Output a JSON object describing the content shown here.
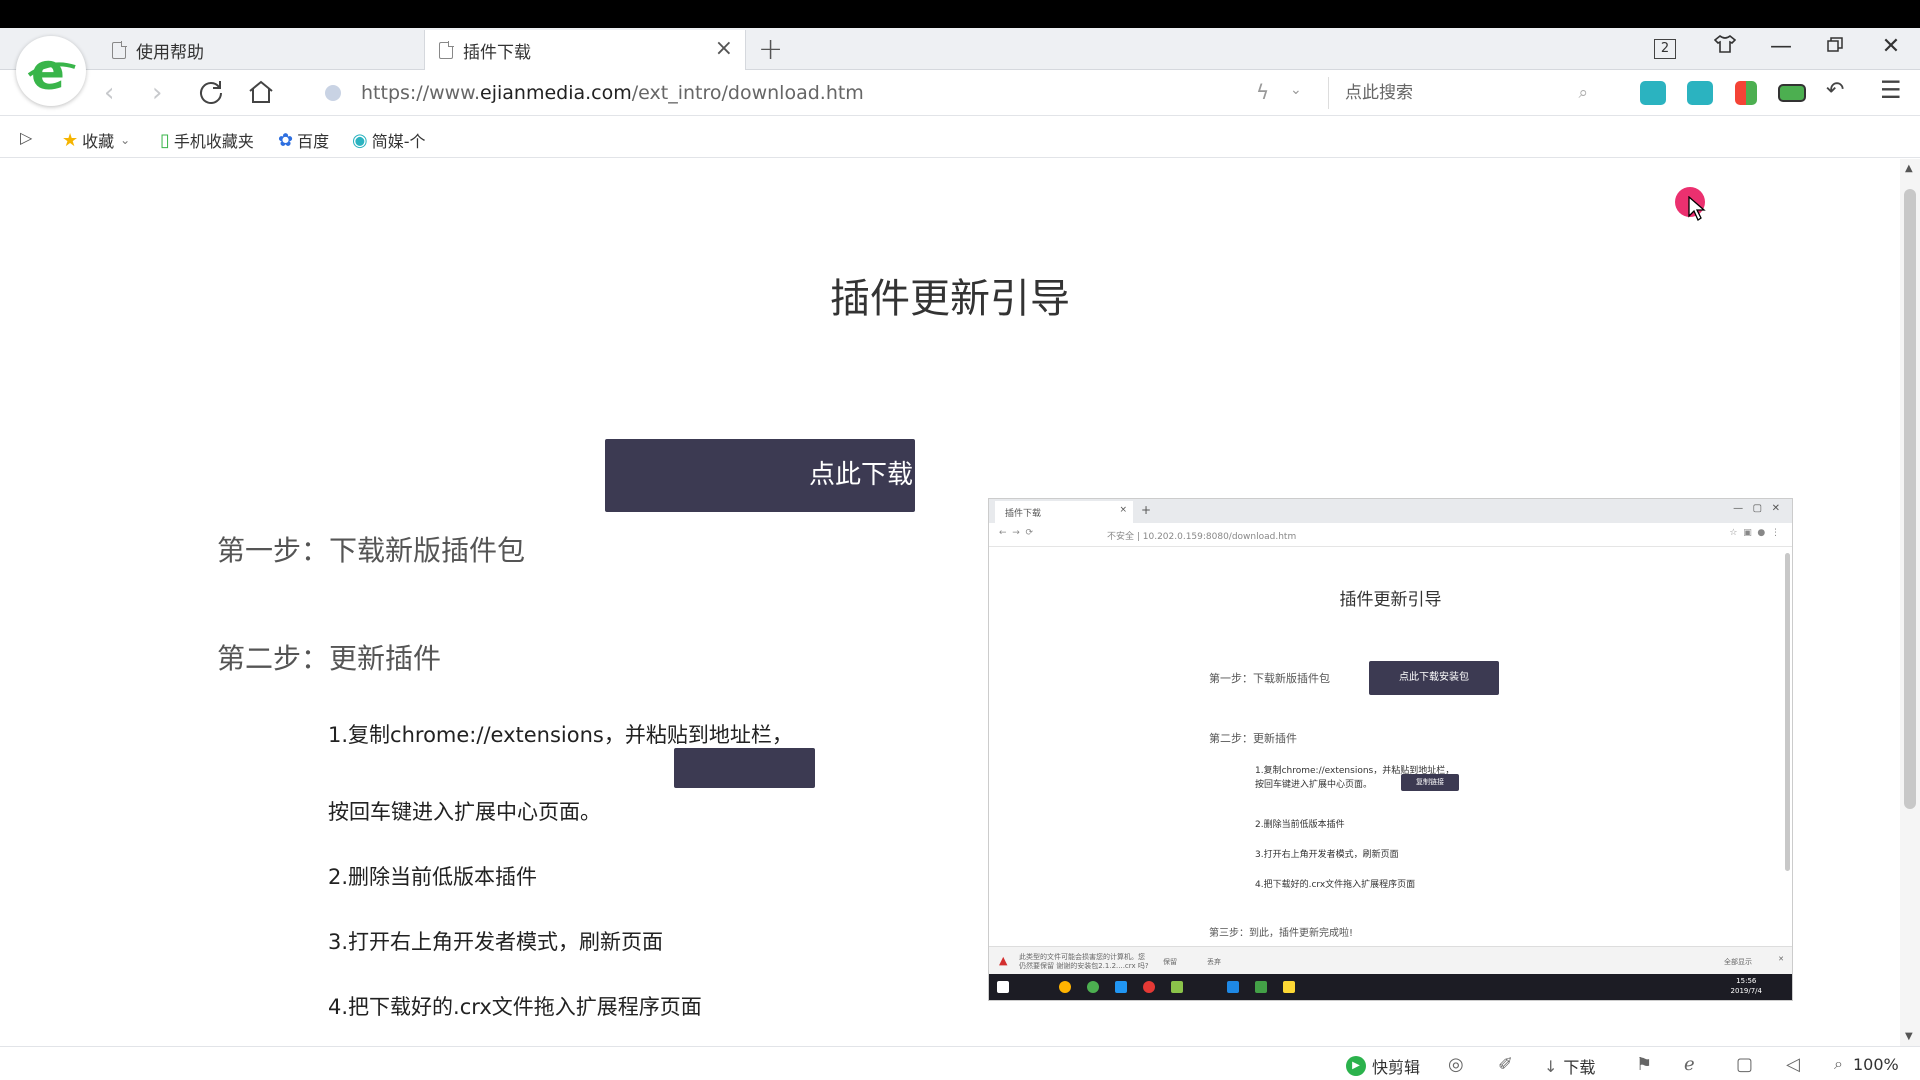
{
  "browser": {
    "tabs": [
      {
        "title": "使用帮助",
        "active": false
      },
      {
        "title": "插件下载",
        "active": true
      }
    ],
    "tab_count": "2",
    "url_prefix": "https://www.",
    "url_host": "ejianmedia.com",
    "url_path": "/ext_intro/download.htm",
    "search_placeholder": "点此搜索",
    "bookmarks": {
      "favorites": "收藏",
      "mobile": "手机收藏夹",
      "baidu": "百度",
      "jianmei": "简媒-个"
    },
    "status": {
      "clip": "快剪辑",
      "download": "下载",
      "zoom": "100%"
    }
  },
  "page": {
    "title": "插件更新引导",
    "download_button": "点此下载",
    "step1": "第一步：下载新版插件包",
    "step2": "第二步：更新插件",
    "sub1": "1.复制chrome://extensions，并粘贴到地址栏，",
    "sub1b": "按回车键进入扩展中心页面。",
    "sub2": "2.删除当前低版本插件",
    "sub3": "3.打开右上角开发者模式，刷新页面",
    "sub4": "4.把下载好的.crx文件拖入扩展程序页面"
  },
  "embedded": {
    "tab_title": "插件下载",
    "url": "不安全 | 10.202.0.159:8080/download.htm",
    "title": "插件更新引导",
    "step1": "第一步：下载新版插件包",
    "download_button": "点此下载安装包",
    "step2": "第二步：更新插件",
    "sub1": "1.复制chrome://extensions，并粘贴到地址栏，",
    "sub1b": "按回车键进入扩展中心页面。",
    "copy_button": "复制链接",
    "sub2": "2.删除当前低版本插件",
    "sub3": "3.打开右上角开发者模式，刷新页面",
    "sub4": "4.把下载好的.crx文件拖入扩展程序页面",
    "step3": "第三步：到此，插件更新完成啦!",
    "dl_warning": "此类型的文件可能会损害您的计算机。您仍然要保留 谢谢的安装包2.1.2....crx 吗?",
    "dl_keep": "保留",
    "dl_discard": "丢弃",
    "dl_show_all": "全部显示",
    "clock": "15:56",
    "date": "2019/7/4"
  },
  "colors": {
    "button_bg": "#3c3a52",
    "cursor_highlight": "#e91e63"
  }
}
